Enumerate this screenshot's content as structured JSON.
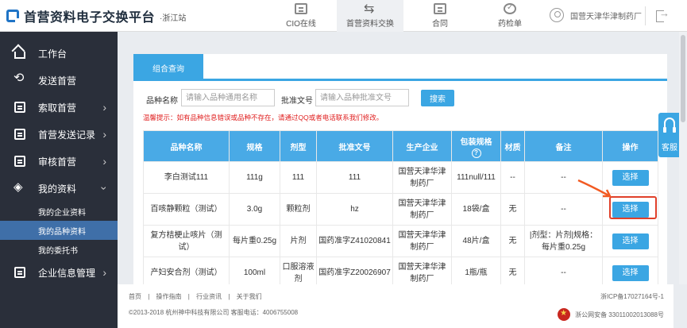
{
  "header": {
    "logo_text": "首营资料电子交换平台",
    "logo_sub": "·浙江站",
    "nav": [
      {
        "label": "CIO在线",
        "icon": "doc-icon"
      },
      {
        "label": "首营资料交换",
        "icon": "exchange-arrows-icon"
      },
      {
        "label": "合同",
        "icon": "contract-icon"
      },
      {
        "label": "药检单",
        "icon": "inspection-icon"
      }
    ],
    "user": "国营天津华津制药厂",
    "active_color": "#3ba6e3"
  },
  "sidebar": {
    "items": [
      {
        "label": "工作台",
        "icon": "home-icon"
      },
      {
        "label": "发送首营",
        "icon": "loop-icon"
      },
      {
        "label": "索取首营",
        "icon": "request-icon"
      },
      {
        "label": "首营发送记录",
        "icon": "record-icon"
      },
      {
        "label": "审核首营",
        "icon": "audit-icon"
      },
      {
        "label": "我的资料",
        "icon": "layers-icon"
      }
    ],
    "subitems": [
      "我的企业资料",
      "我的品种资料",
      "我的委托书"
    ],
    "bottom_item": {
      "label": "企业信息管理",
      "icon": "enterprise-icon"
    }
  },
  "panel": {
    "tab": "组合查询",
    "search": {
      "variety_label": "品种名称",
      "variety_placeholder": "请输入品种通用名称",
      "approval_label": "批准文号",
      "approval_placeholder": "请输入品种批准文号",
      "button": "搜索"
    },
    "hint": "温馨提示：如有品种信息错误或品种不存在，请通过QQ或者电话联系我们修改。"
  },
  "table": {
    "headers": [
      "品种名称",
      "规格",
      "剂型",
      "批准文号",
      "生产企业",
      "包装规格",
      "材质",
      "备注",
      "操作"
    ],
    "help_icon": "?",
    "rows": [
      {
        "name": "李白测试111",
        "spec": "111g",
        "form": "111",
        "approval": "111",
        "maker": "国营天津华津制药厂",
        "pack": "111null/111",
        "material": "--",
        "note": "--",
        "action": "选择"
      },
      {
        "name": "百咳静颗粒（测试）",
        "spec": "3.0g",
        "form": "颗粒剂",
        "approval": "hz",
        "maker": "国营天津华津制药厂",
        "pack": "18袋/盒",
        "material": "无",
        "note": "--",
        "action": "选择"
      },
      {
        "name": "复方桔梗止咳片（测试）",
        "spec": "每片重0.25g",
        "form": "片剂",
        "approval": "国药准字Z41020841",
        "maker": "国营天津华津制药厂",
        "pack": "48片/盒",
        "material": "无",
        "note": "|剂型：片剂|规格：每片重0.25g",
        "action": "选择"
      },
      {
        "name": "产妇安合剂（测试）",
        "spec": "100ml",
        "form": "口服溶液剂",
        "approval": "国药准字Z20026907",
        "maker": "国营天津华津制药厂",
        "pack": "1瓶/瓶",
        "material": "无",
        "note": "--",
        "action": "选择"
      }
    ]
  },
  "footer": {
    "links": [
      "首页",
      "|",
      "操作指南",
      "|",
      "行业资讯",
      "|",
      "关于我们"
    ],
    "copyright": "©2013-2018   杭州神中科技有限公司   客服电话：4006755008",
    "icp": "浙ICP备17027164号-1",
    "police": "浙公网安备 33011002013088号"
  },
  "cs_float": {
    "label": "客服"
  }
}
